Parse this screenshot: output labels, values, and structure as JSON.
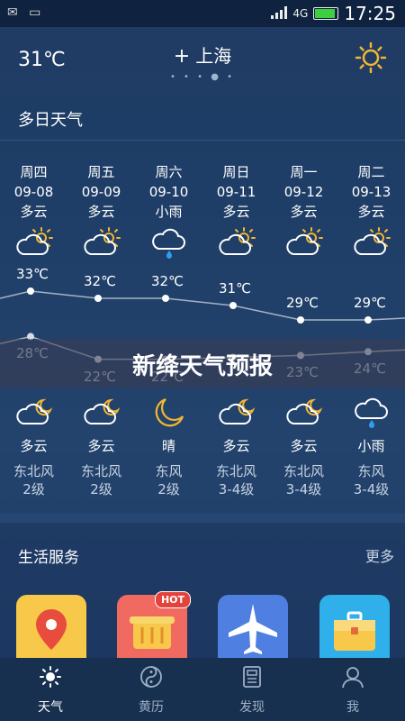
{
  "status_bar": {
    "left_icons": "✉ ▭",
    "time": "17:25",
    "network": "4G"
  },
  "header": {
    "current_temp": "31℃",
    "city_prefix": "+",
    "city": "上海",
    "page_dots": "• • • ●  •"
  },
  "forecast": {
    "title": "多日天气",
    "days": [
      {
        "weekday": "周四",
        "date": "09-08",
        "day_weather": "多云",
        "day_icon": "partly-cloudy-day-icon",
        "high": "33℃",
        "low": "28℃",
        "night_icon": "partly-cloudy-night-icon",
        "night_weather": "多云",
        "wind": "东北风",
        "wind_level": "2级"
      },
      {
        "weekday": "周五",
        "date": "09-09",
        "day_weather": "多云",
        "day_icon": "partly-cloudy-day-icon",
        "high": "32℃",
        "low": "22℃",
        "night_icon": "partly-cloudy-night-icon",
        "night_weather": "多云",
        "wind": "东北风",
        "wind_level": "2级"
      },
      {
        "weekday": "周六",
        "date": "09-10",
        "day_weather": "小雨",
        "day_icon": "light-rain-icon",
        "high": "32℃",
        "low": "22℃",
        "night_icon": "clear-night-moon-icon",
        "night_weather": "晴",
        "wind": "东风",
        "wind_level": "2级"
      },
      {
        "weekday": "周日",
        "date": "09-11",
        "day_weather": "多云",
        "day_icon": "partly-cloudy-day-icon",
        "high": "31℃",
        "low": "",
        "night_icon": "partly-cloudy-night-icon",
        "night_weather": "多云",
        "wind": "东北风",
        "wind_level": "3-4级"
      },
      {
        "weekday": "周一",
        "date": "09-12",
        "day_weather": "多云",
        "day_icon": "partly-cloudy-day-icon",
        "high": "29℃",
        "low": "23℃",
        "night_icon": "partly-cloudy-night-icon",
        "night_weather": "多云",
        "wind": "东北风",
        "wind_level": "3-4级"
      },
      {
        "weekday": "周二",
        "date": "09-13",
        "day_weather": "多云",
        "day_icon": "partly-cloudy-day-icon",
        "high": "29℃",
        "low": "24℃",
        "night_icon": "light-rain-icon",
        "night_weather": "小雨",
        "wind": "东风",
        "wind_level": "3-4级"
      }
    ]
  },
  "banner": {
    "text": "新绛天气预报"
  },
  "life_services": {
    "title": "生活服务",
    "more": "更多",
    "hot_badge": "HOT"
  },
  "tabs": [
    {
      "label": "天气"
    },
    {
      "label": "黄历"
    },
    {
      "label": "发现"
    },
    {
      "label": "我"
    }
  ],
  "colors": {
    "accent_sun": "#f2b632",
    "service_map": "#f7c84a",
    "service_basket": "#f06a61",
    "service_plane": "#4f7fe0",
    "service_case": "#2fb0ea"
  }
}
